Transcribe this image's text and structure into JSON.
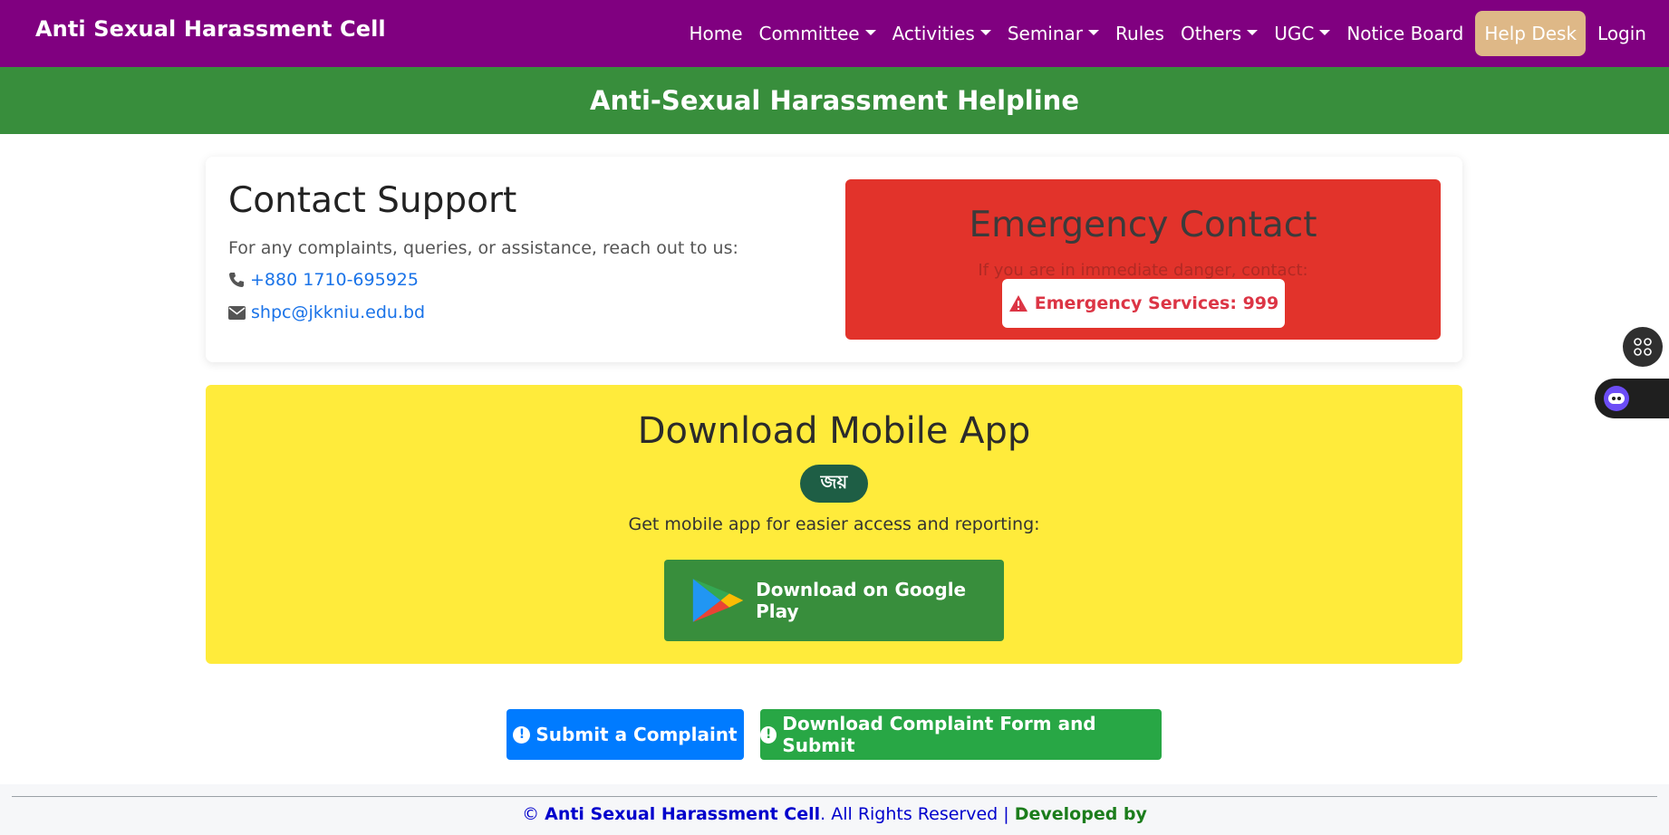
{
  "navbar": {
    "brand": "Anti Sexual Harassment Cell",
    "items": [
      {
        "label": "Home",
        "dropdown": false
      },
      {
        "label": "Committee",
        "dropdown": true
      },
      {
        "label": "Activities",
        "dropdown": true
      },
      {
        "label": "Seminar",
        "dropdown": true
      },
      {
        "label": "Rules",
        "dropdown": false
      },
      {
        "label": "Others",
        "dropdown": true
      },
      {
        "label": "UGC",
        "dropdown": true
      },
      {
        "label": "Notice Board",
        "dropdown": false
      },
      {
        "label": "Help Desk",
        "dropdown": false,
        "active": true
      },
      {
        "label": "Login",
        "dropdown": false
      }
    ]
  },
  "banner": {
    "title": "Anti-Sexual Harassment Helpline"
  },
  "contact": {
    "title": "Contact Support",
    "description": "For any complaints, queries, or assistance, reach out to us:",
    "phone": "+880 1710-695925",
    "email": "shpc@jkkniu.edu.bd"
  },
  "emergency": {
    "title": "Emergency Contact",
    "subtitle": "If you are in immediate danger, contact:",
    "button_label": "Emergency Services: 999"
  },
  "app": {
    "title": "Download Mobile App",
    "logo_text": "জয়",
    "description": "Get mobile app for easier access and reporting:",
    "play_button_label": "Download on Google Play"
  },
  "actions": {
    "submit_label": "Submit a Complaint",
    "download_form_label": "Download Complaint Form and Submit"
  },
  "footer": {
    "copyright_symbol": "©",
    "org_name": "Anti Sexual Harassment Cell",
    "rights": ". All Rights Reserved |",
    "developed_by": "Developed by"
  },
  "colors": {
    "navbar": "#800080",
    "banner": "#388e3c",
    "helpdesk_active": "#deb887",
    "emergency": "#e2332b",
    "app_card": "#ffeb3b",
    "primary": "#007bff",
    "success": "#28a745"
  },
  "icons": [
    "phone-icon",
    "envelope-icon",
    "warning-triangle-icon",
    "google-play-icon",
    "exclamation-circle-icon",
    "command-icon",
    "bot-icon",
    "caret-down-icon"
  ]
}
